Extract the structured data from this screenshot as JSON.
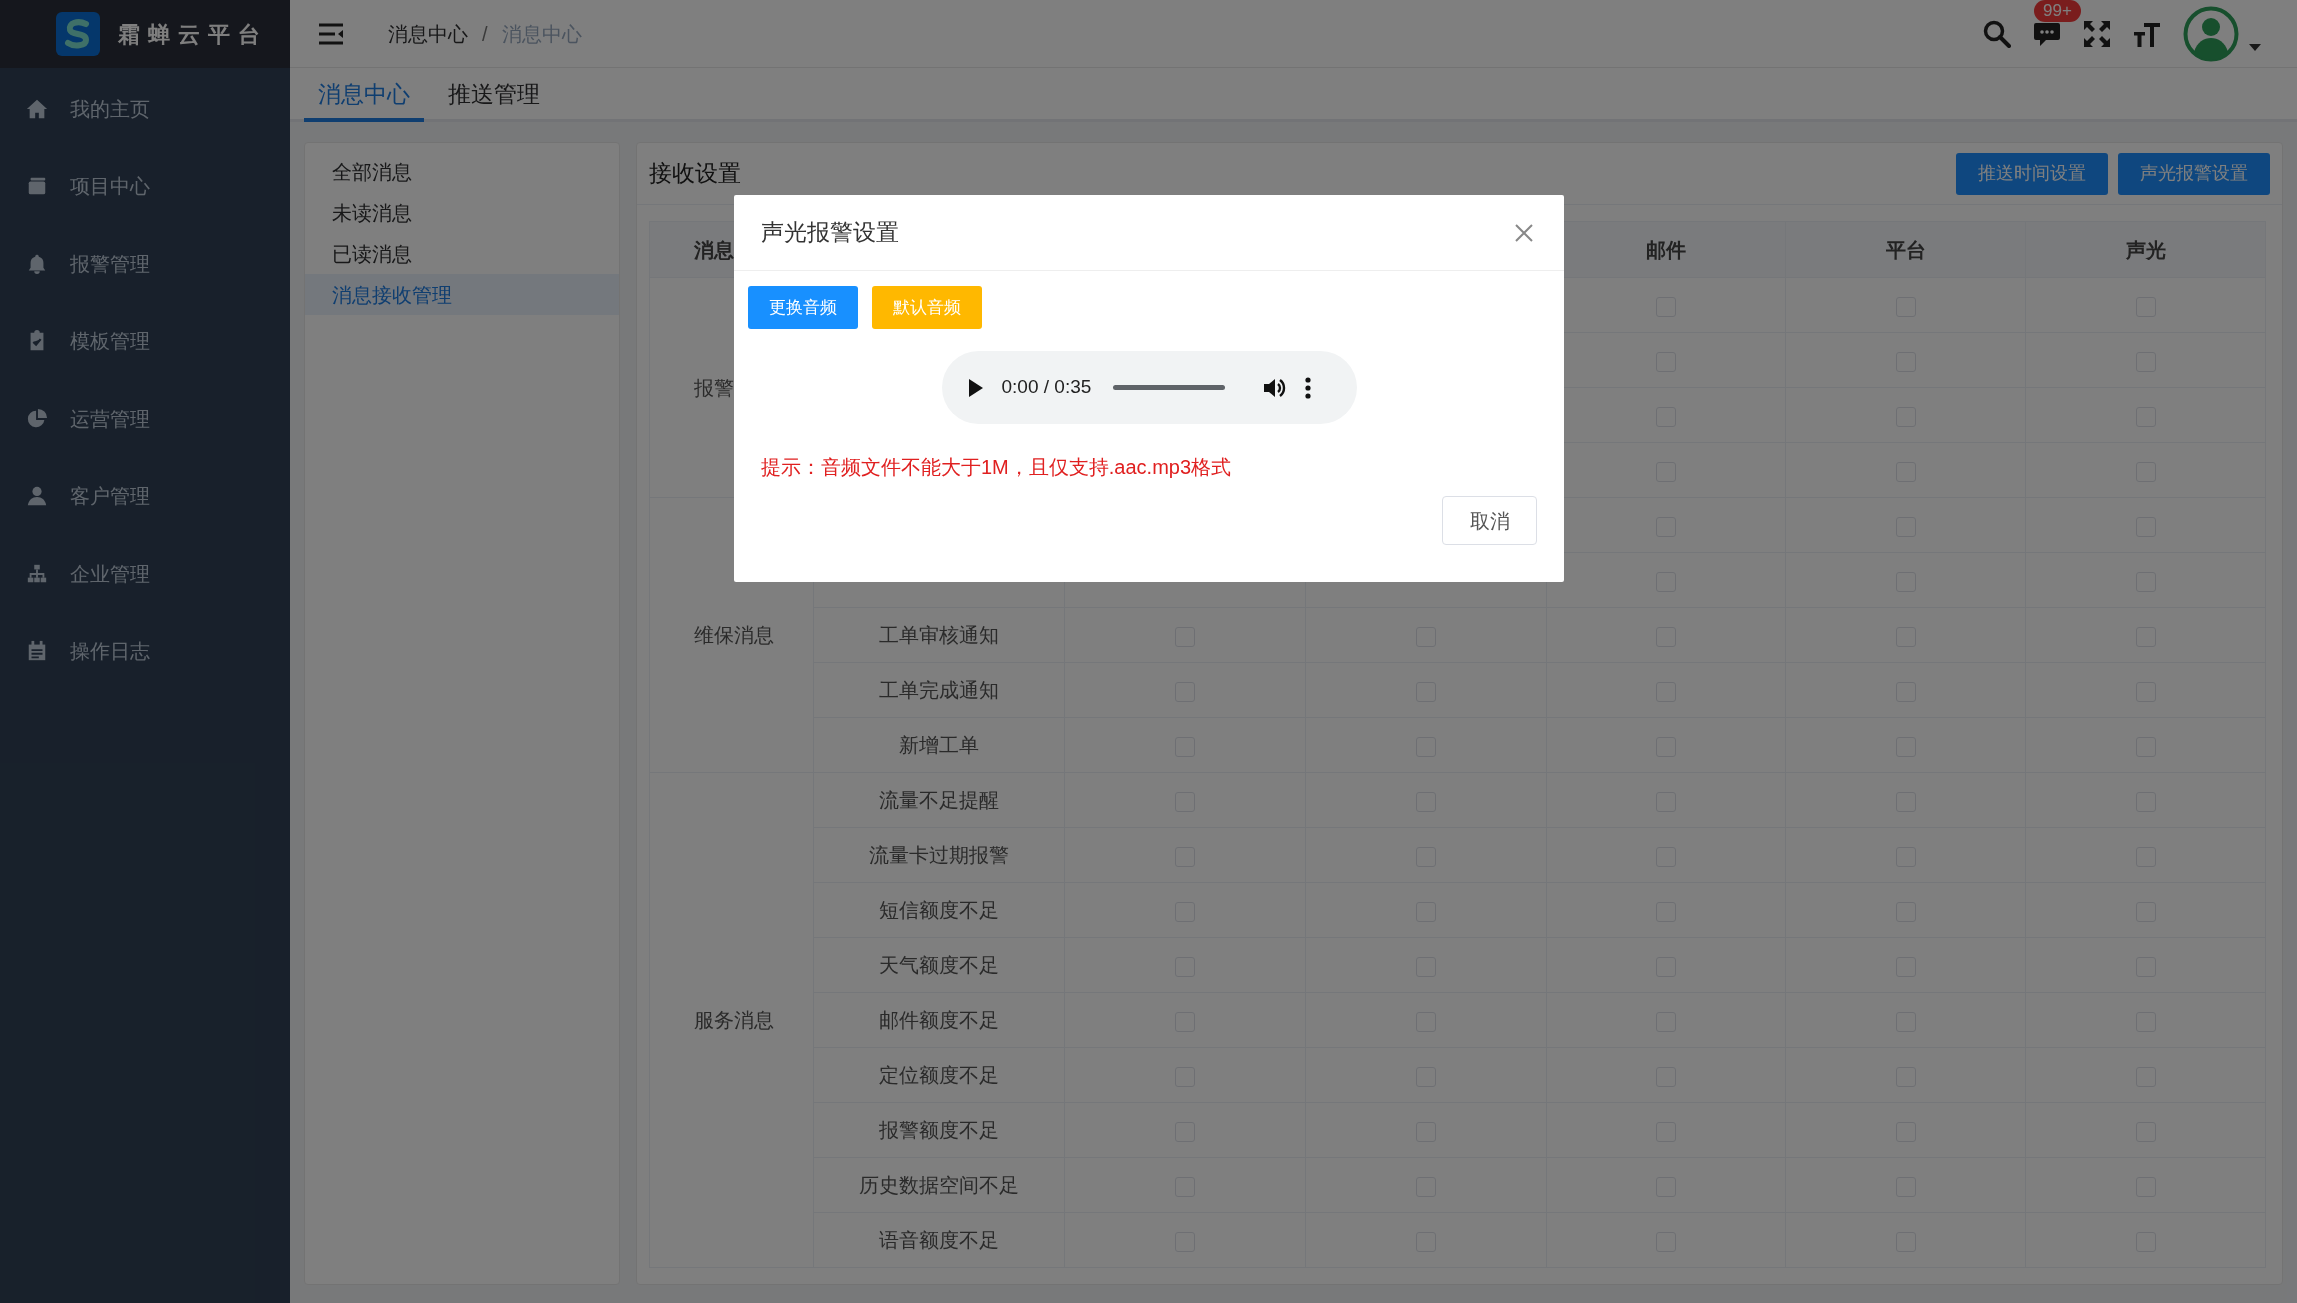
{
  "sidebar": {
    "title": "霜蝉云平台",
    "items": [
      {
        "label": "我的主页"
      },
      {
        "label": "项目中心"
      },
      {
        "label": "报警管理"
      },
      {
        "label": "模板管理"
      },
      {
        "label": "运营管理"
      },
      {
        "label": "客户管理"
      },
      {
        "label": "企业管理"
      },
      {
        "label": "操作日志"
      }
    ]
  },
  "header": {
    "breadcrumb": [
      {
        "label": "消息中心",
        "current": false
      },
      {
        "label": "消息中心",
        "current": true
      }
    ],
    "separator": "/",
    "badge": "99+"
  },
  "tabs": [
    {
      "label": "消息中心",
      "selected": true
    },
    {
      "label": "推送管理",
      "selected": false
    }
  ],
  "message_menu": [
    {
      "label": "全部消息",
      "selected": false
    },
    {
      "label": "未读消息",
      "selected": false
    },
    {
      "label": "已读消息",
      "selected": false
    },
    {
      "label": "消息接收管理",
      "selected": true
    }
  ],
  "panel": {
    "title": "接收设置",
    "buttons": [
      "推送时间设置",
      "声光报警设置"
    ]
  },
  "table": {
    "columns": [
      {
        "label": "消息"
      },
      {},
      {},
      {},
      {
        "label": "邮件"
      },
      {
        "label": "平台"
      },
      {
        "label": "声光"
      }
    ],
    "groups": [
      {
        "label": "报警",
        "rows": [
          {
            "checks": [
              false,
              false,
              false
            ]
          },
          {
            "checks": [
              false,
              false,
              false
            ]
          },
          {
            "checks": [
              false,
              false,
              false
            ]
          },
          {
            "checks": [
              false,
              false,
              false
            ]
          }
        ]
      },
      {
        "label": "维保消息",
        "rows": [
          {
            "checks": [
              false,
              false,
              false
            ]
          },
          {
            "checks": [
              false,
              false,
              false
            ]
          },
          {
            "label": "工单审核通知",
            "checks": [
              false,
              false,
              false,
              false,
              false
            ]
          },
          {
            "label": "工单完成通知",
            "checks": [
              false,
              false,
              false,
              false,
              false
            ]
          },
          {
            "label": "新增工单",
            "checks": [
              false,
              false,
              false,
              false,
              false
            ]
          }
        ]
      },
      {
        "label": "服务消息",
        "rows": [
          {
            "label": "流量不足提醒",
            "checks": [
              false,
              false,
              false,
              false,
              false
            ]
          },
          {
            "label": "流量卡过期报警",
            "checks": [
              false,
              false,
              false,
              false,
              false
            ]
          },
          {
            "label": "短信额度不足",
            "checks": [
              false,
              false,
              false,
              false,
              false
            ]
          },
          {
            "label": "天气额度不足",
            "checks": [
              false,
              false,
              false,
              false,
              false
            ]
          },
          {
            "label": "邮件额度不足",
            "checks": [
              false,
              false,
              false,
              false,
              false
            ]
          },
          {
            "label": "定位额度不足",
            "checks": [
              false,
              false,
              false,
              false,
              false
            ]
          },
          {
            "label": "报警额度不足",
            "checks": [
              false,
              false,
              false,
              false,
              false
            ]
          },
          {
            "label": "历史数据空间不足",
            "checks": [
              false,
              false,
              false,
              false,
              false
            ]
          },
          {
            "label": "语音额度不足",
            "checks": [
              false,
              false,
              false,
              false,
              false
            ]
          }
        ]
      }
    ]
  },
  "dialog": {
    "title": "声光报警设置",
    "buttons": [
      {
        "label": "更换音频",
        "kind": "primary"
      },
      {
        "label": "默认音频",
        "kind": "warning"
      }
    ],
    "player": {
      "time": "0:00 / 0:35",
      "level": 0
    },
    "hint": "提示：音频文件不能大于1M，且仅支持.aac.mp3格式",
    "cancel": "取消"
  }
}
